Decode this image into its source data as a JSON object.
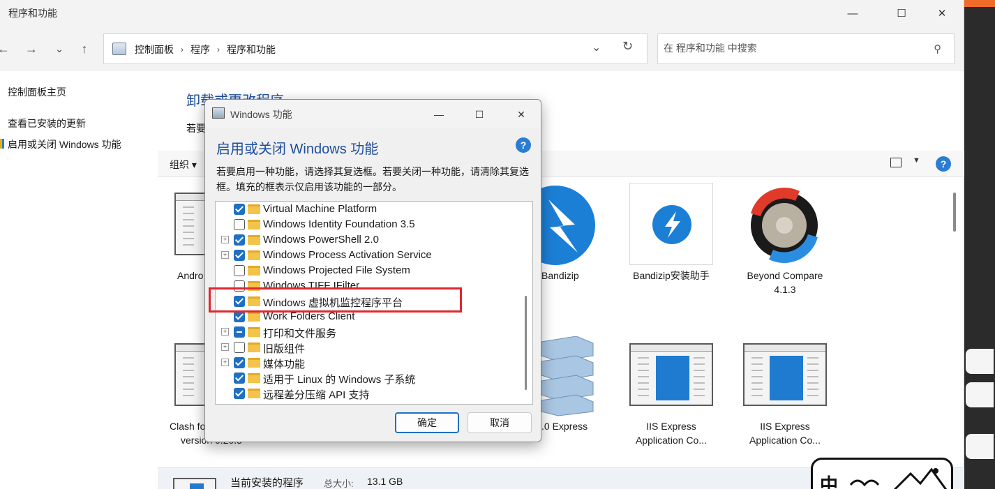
{
  "window": {
    "title": "程序和功能",
    "minimize": "—",
    "maximize": "☐",
    "close": "✕"
  },
  "nav": {
    "back": "←",
    "forward": "→",
    "recent": "⌄",
    "up": "↑"
  },
  "address": {
    "crumbs": [
      "控制面板",
      "程序",
      "程序和功能"
    ],
    "dropdown": "⌄",
    "refresh": "↻"
  },
  "search": {
    "placeholder": "在 程序和功能 中搜索",
    "icon": "⚲"
  },
  "left_pane": {
    "home": "控制面板主页",
    "updates": "查看已安装的更新",
    "features": "启用或关闭 Windows 功能"
  },
  "main": {
    "heading": "卸载或更改程序",
    "subtext": "若要",
    "organize": "组织 ▾",
    "view_dropdown": "▼",
    "help": "?"
  },
  "apps": [
    {
      "label": "Andro"
    },
    {
      "label": "Bandizip"
    },
    {
      "label": "Bandizip安装助手"
    },
    {
      "label_line1": "Beyond Compare",
      "label_line2": "4.1.3"
    },
    {
      "label_line1": "Clash fo",
      "label_line2": "version 0.20.5"
    },
    {
      "label": ".0 Express"
    },
    {
      "label_line1": "IIS Express",
      "label_line2": "Application Co..."
    },
    {
      "label_line1": "IIS Express",
      "label_line2": "Application Co..."
    }
  ],
  "status": {
    "current_programs": "当前安装的程序",
    "total_size_label": "总大小:",
    "total_size": "13.1 GB"
  },
  "watermark": {
    "text": "中"
  },
  "dialog": {
    "title": "Windows 功能",
    "heading": "启用或关闭 Windows 功能",
    "help": "?",
    "description": "若要启用一种功能，请选择其复选框。若要关闭一种功能，请清除其复选框。填充的框表示仅启用该功能的一部分。",
    "features": [
      {
        "label": "Virtual Machine Platform",
        "state": "on",
        "expandable": false
      },
      {
        "label": "Windows Identity Foundation 3.5",
        "state": "off",
        "expandable": false
      },
      {
        "label": "Windows PowerShell 2.0",
        "state": "on",
        "expandable": true
      },
      {
        "label": "Windows Process Activation Service",
        "state": "on",
        "expandable": true
      },
      {
        "label": "Windows Projected File System",
        "state": "off",
        "expandable": false
      },
      {
        "label": "Windows TIFF IFilter",
        "state": "off",
        "expandable": false
      },
      {
        "label": "Windows 虚拟机监控程序平台",
        "state": "on",
        "expandable": false
      },
      {
        "label": "Work Folders Client",
        "state": "on",
        "expandable": false
      },
      {
        "label": "打印和文件服务",
        "state": "partial",
        "expandable": true
      },
      {
        "label": "旧版组件",
        "state": "off",
        "expandable": true
      },
      {
        "label": "媒体功能",
        "state": "on",
        "expandable": true
      },
      {
        "label": "适用于 Linux 的 Windows 子系统",
        "state": "on",
        "expandable": false
      },
      {
        "label": "远程差分压缩 API 支持",
        "state": "on",
        "expandable": false
      }
    ],
    "ok": "确定",
    "cancel": "取消"
  },
  "colors": {
    "accent": "#1f6fc5",
    "heading_blue": "#1f4e9c",
    "highlight_red": "#e0262e",
    "folder": "#f4c44a"
  }
}
